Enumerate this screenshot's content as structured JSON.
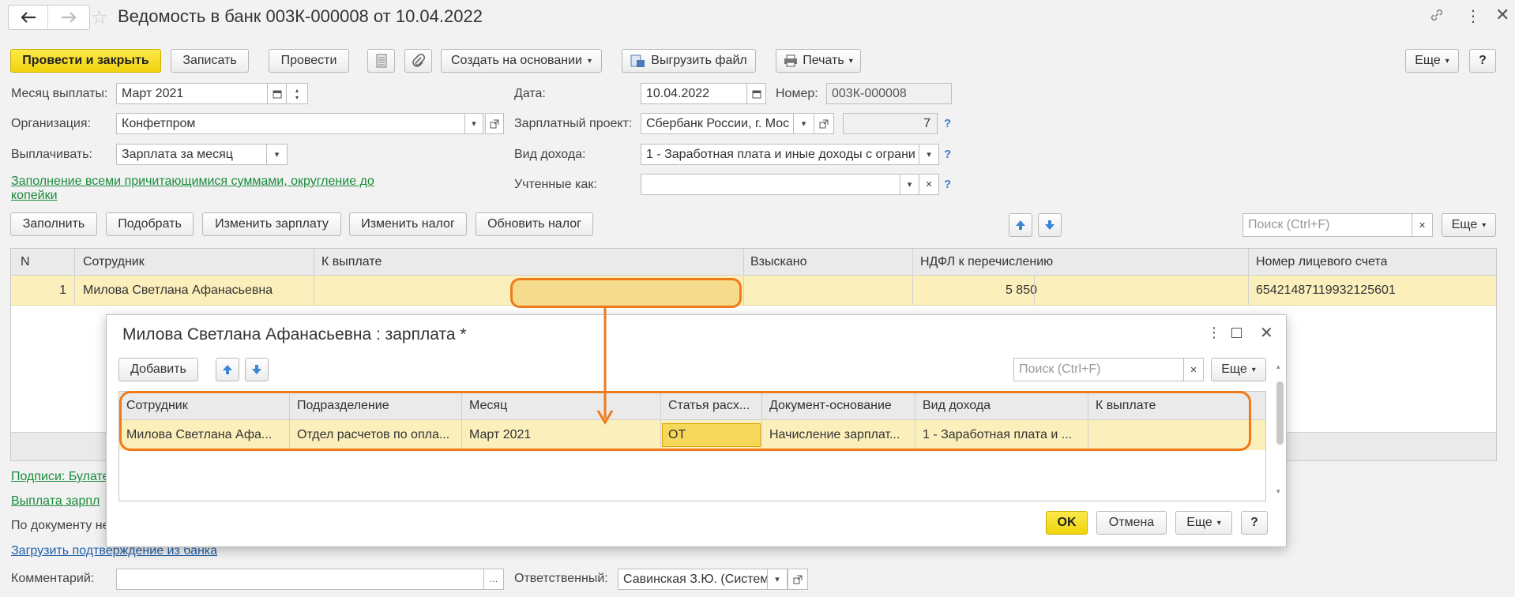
{
  "window": {
    "title": "Ведомость в банк 003К-000008 от 10.04.2022"
  },
  "toolbar": {
    "post_close": "Провести и закрыть",
    "save": "Записать",
    "post": "Провести",
    "create_based": "Создать на основании",
    "export_file": "Выгрузить файл",
    "print": "Печать",
    "more": "Еще",
    "help": "?"
  },
  "form": {
    "month_label": "Месяц выплаты:",
    "month_value": "Март 2021",
    "org_label": "Организация:",
    "org_value": "Конфетпром",
    "pay_label": "Выплачивать:",
    "pay_value": "Зарплата за месяц",
    "fill_link": "Заполнение всеми причитающимися суммами, округление до копейки",
    "date_label": "Дата:",
    "date_value": "10.04.2022",
    "number_label": "Номер:",
    "number_value": "003К-000008",
    "project_label": "Зарплатный проект:",
    "project_value": "Сбербанк России, г. Мос",
    "project_count": "7",
    "income_label": "Вид дохода:",
    "income_value": "1 - Заработная плата и иные доходы с ограни",
    "counted_label": "Учтенные как:",
    "counted_value": ""
  },
  "table_toolbar": {
    "fill": "Заполнить",
    "pick": "Подобрать",
    "change_salary": "Изменить зарплату",
    "change_tax": "Изменить налог",
    "update_tax": "Обновить налог",
    "search_placeholder": "Поиск (Ctrl+F)",
    "more": "Еще"
  },
  "table": {
    "headers": [
      "N",
      "Сотрудник",
      "К выплате",
      "Взыскано",
      "НДФЛ к перечислению",
      "Номер лицевого счета"
    ],
    "rows": [
      {
        "n": "1",
        "employee": "Милова Светлана Афанасьевна",
        "pay": "",
        "withheld": "",
        "ndfl": "5 850",
        "account": "65421487119932125601"
      }
    ]
  },
  "footer": {
    "signatures": "Подписи: Булате",
    "payment": "Выплата зарпл",
    "doc_text": "По документу не",
    "load_confirmation": "Загрузить подтверждение из банка",
    "comment_label": "Комментарий:",
    "comment_value": "",
    "responsible_label": "Ответственный:",
    "responsible_value": "Савинская З.Ю. (Систем"
  },
  "dialog": {
    "title": "Милова Светлана Афанасьевна : зарплата *",
    "add": "Добавить",
    "search_placeholder": "Поиск (Ctrl+F)",
    "more": "Еще",
    "headers": [
      "Сотрудник",
      "Подразделение",
      "Месяц",
      "Статья расх...",
      "Документ-основание",
      "Вид дохода",
      "К выплате"
    ],
    "rows": [
      {
        "employee": "Милова Светлана Афа...",
        "department": "Отдел расчетов по опла...",
        "month": "Март 2021",
        "article": "ОТ",
        "doc": "Начисление зарплат...",
        "income": "1 - Заработная плата и ...",
        "pay": ""
      }
    ],
    "ok": "OK",
    "cancel": "Отмена",
    "more2": "Еще",
    "help": "?"
  },
  "colors": {
    "highlight_row": "#fbefbb",
    "annotation": "#f07a1a",
    "primary_button": "#f5dc1c"
  }
}
